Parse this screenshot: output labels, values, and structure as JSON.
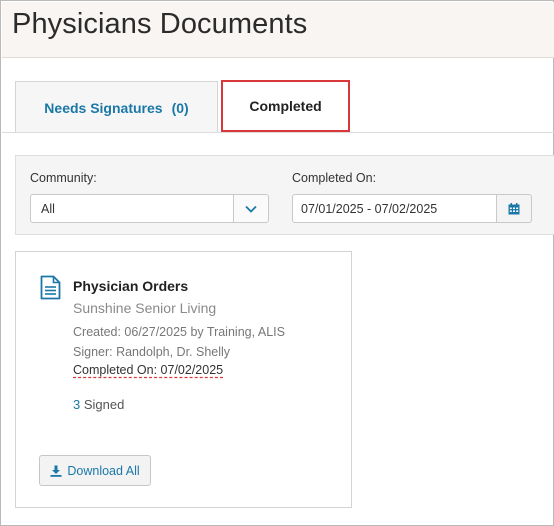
{
  "page": {
    "title": "Physicians Documents"
  },
  "tabs": [
    {
      "label": "Needs Signatures",
      "count": "(0)",
      "active": false
    },
    {
      "label": "Completed",
      "active": true
    }
  ],
  "filters": {
    "community_label": "Community:",
    "community_value": "All",
    "completed_on_label": "Completed On:",
    "completed_on_value": "07/01/2025 - 07/02/2025"
  },
  "card": {
    "icon": "document-icon",
    "title": "Physician Orders",
    "subtitle": "Sunshine Senior Living",
    "created": "Created: 06/27/2025 by Training, ALIS",
    "signer": "Signer: Randolph, Dr. Shelly",
    "completed_on": "Completed On: 07/02/2025",
    "signed_count": "3",
    "signed_label": "Signed",
    "download_label": "Download All"
  },
  "colors": {
    "link": "#1a78a8",
    "highlight": "#d9383a",
    "header_bg": "#f8f5f3"
  }
}
